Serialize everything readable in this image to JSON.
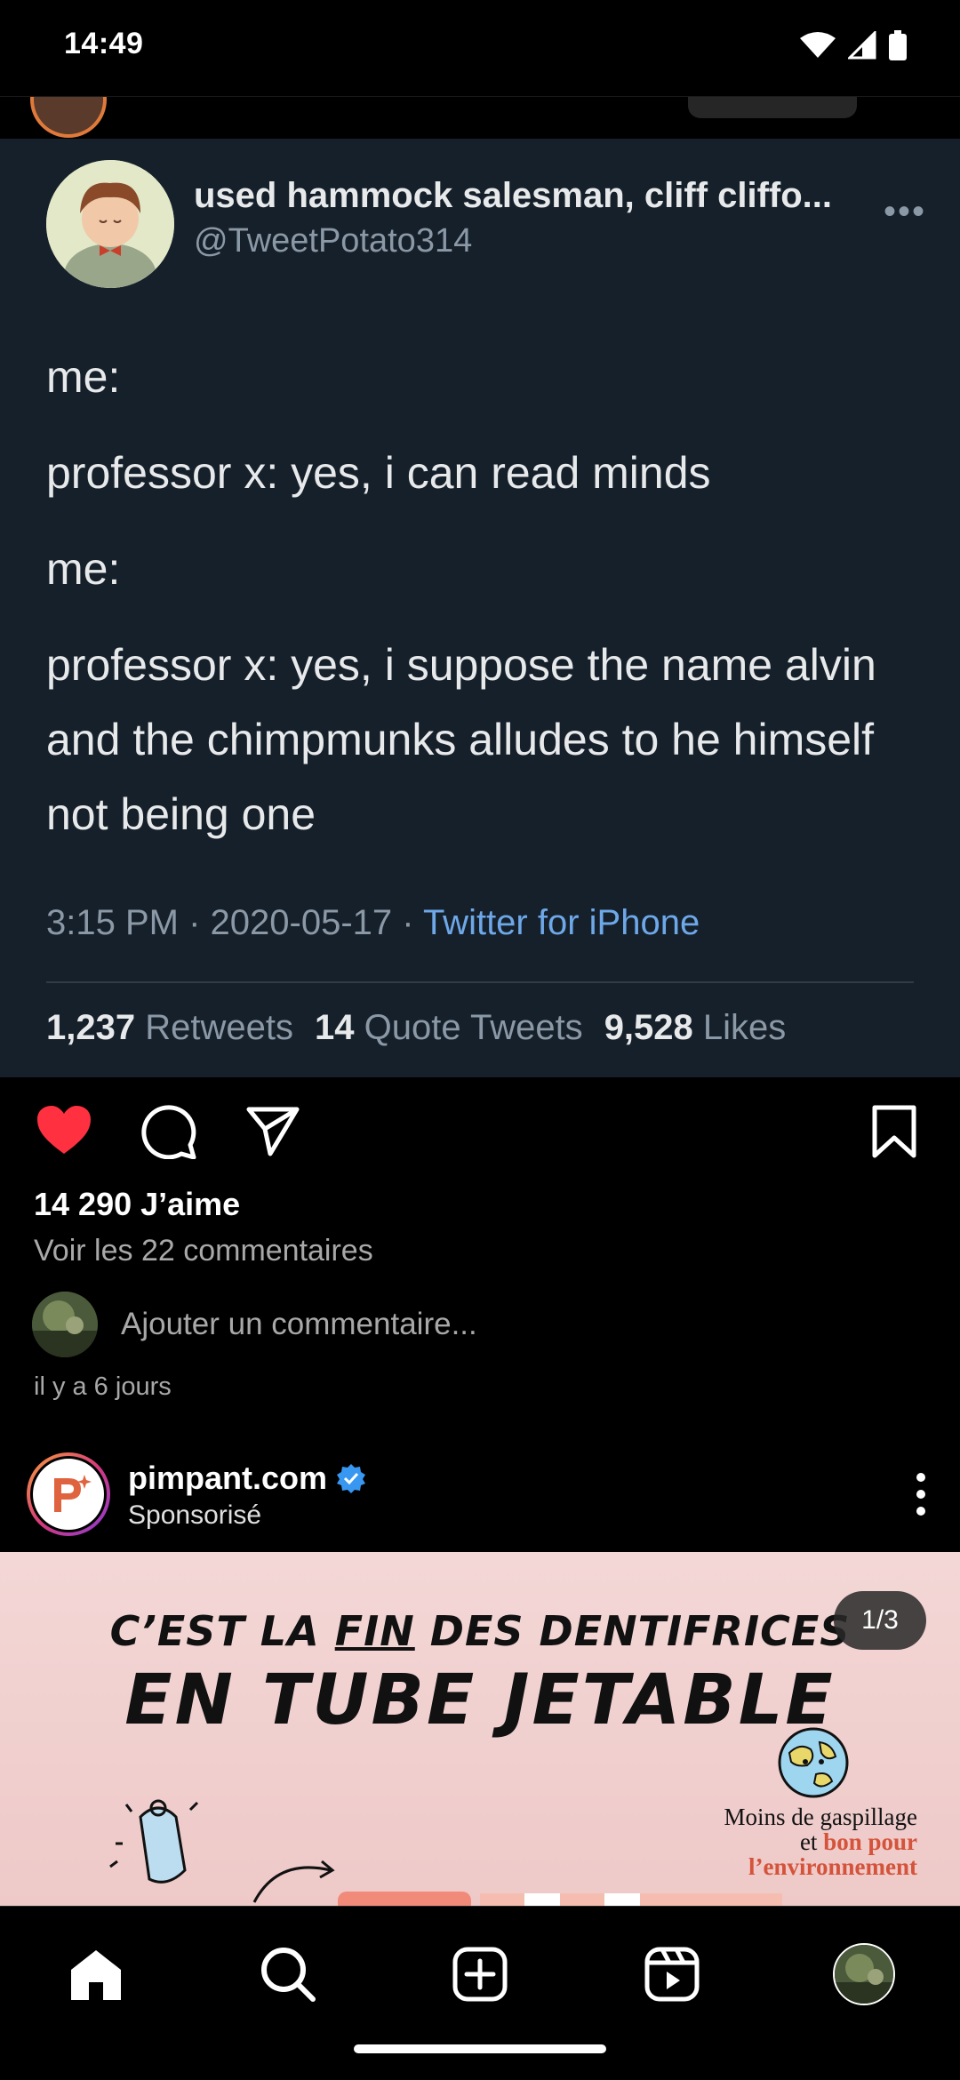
{
  "status_bar": {
    "time": "14:49"
  },
  "tweet": {
    "name": "used hammock salesman, cliff cliffo...",
    "handle": "@TweetPotato314",
    "more": "•••",
    "lines": [
      "me:",
      "professor x: yes, i can read minds",
      "me:",
      "professor x: yes, i suppose the name alvin and the chimpmunks alludes to he himself not being one"
    ],
    "time": "3:15 PM",
    "sep": " · ",
    "date": "2020-05-17",
    "source": "Twitter for iPhone",
    "stats": {
      "retweets_count": "1,237",
      "retweets_label": "Retweets",
      "quotes_count": "14",
      "quotes_label": "Quote Tweets",
      "likes_count": "9,528",
      "likes_label": "Likes"
    }
  },
  "post": {
    "likes": "14 290 J’aime",
    "view_comments": "Voir les 22 commentaires",
    "add_comment_placeholder": "Ajouter un commentaire...",
    "time_ago": "il y a 6 jours"
  },
  "sponsored": {
    "name": "pimpant.com",
    "label": "Sponsorisé",
    "ad": {
      "line1_a": "C’EST LA ",
      "line1_u": "FIN",
      "line1_b": " DES DENTIFRICES",
      "line2": "EN TUBE JETABLE",
      "counter": "1/3",
      "caption_1": "Moins de gaspillage",
      "caption_2a": "et ",
      "caption_2b": "bon pour",
      "caption_3": "l’environnement"
    }
  },
  "colors": {
    "tweet_bg": "#15202b",
    "twitter_link": "#6ea8e8",
    "like_red": "#ff3040",
    "verified_blue": "#3897f0"
  }
}
